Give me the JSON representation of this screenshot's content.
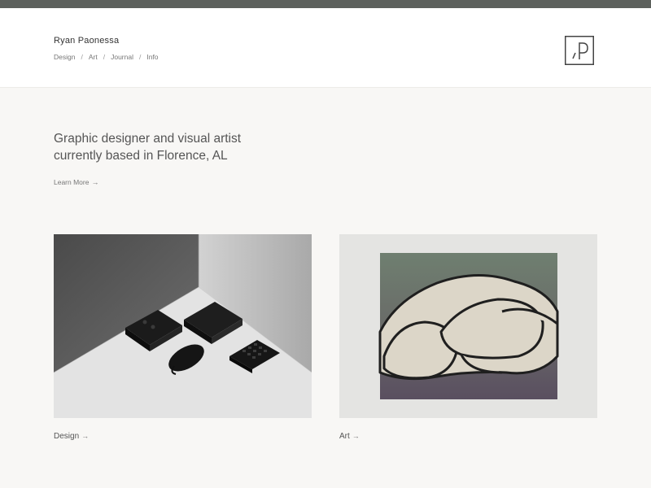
{
  "header": {
    "site_title": "Ryan Paonessa",
    "nav": [
      {
        "label": "Design"
      },
      {
        "label": "Art"
      },
      {
        "label": "Journal"
      },
      {
        "label": "Info"
      }
    ],
    "separator": "/"
  },
  "hero": {
    "line1": "Graphic designer and visual artist",
    "line2": "currently based in Florence, AL",
    "learn_more": "Learn More"
  },
  "cards": [
    {
      "label": "Design",
      "icon": "arrow-right-icon"
    },
    {
      "label": "Art",
      "icon": "arrow-right-icon"
    }
  ],
  "colors": {
    "topbar": "#5d615d",
    "background": "#f8f7f5",
    "header_bg": "#ffffff",
    "text": "#3c3c3c"
  }
}
